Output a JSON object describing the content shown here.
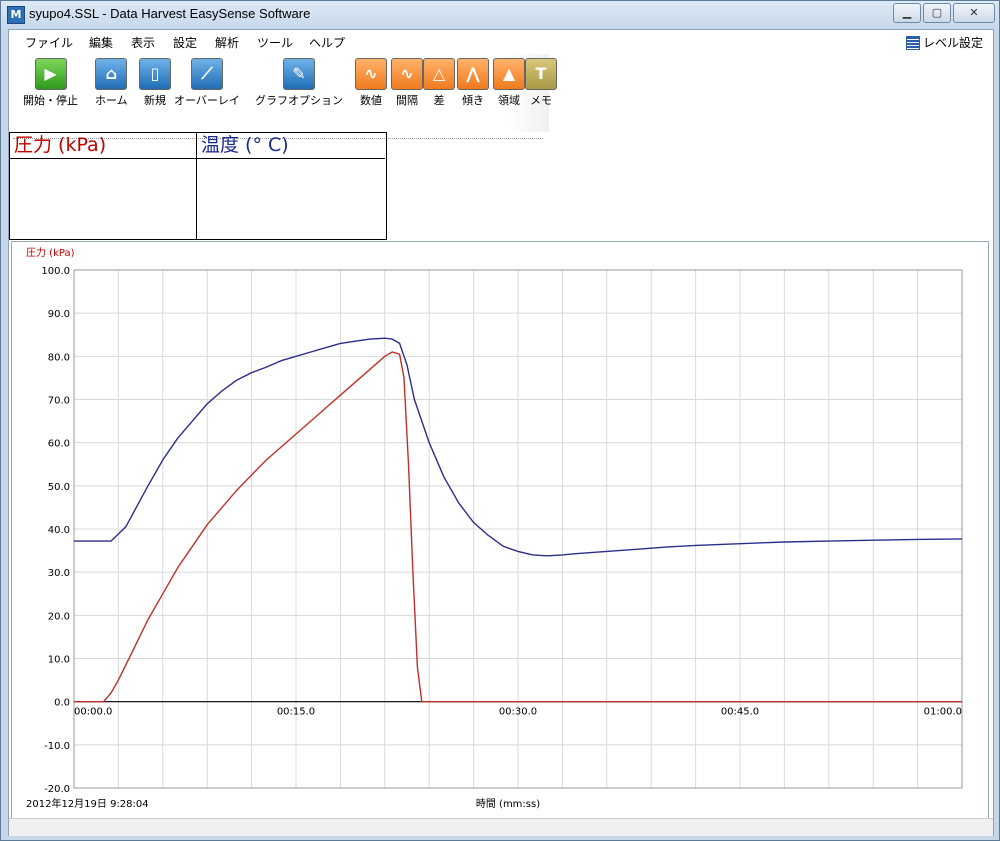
{
  "window": {
    "title": "syupo4.SSL - Data Harvest EasySense Software",
    "app_icon": "M"
  },
  "window_buttons": {
    "minimize": "▁",
    "maximize": "▢",
    "close": "✕"
  },
  "menu": [
    {
      "label": "ファイル"
    },
    {
      "label": "編集"
    },
    {
      "label": "表示"
    },
    {
      "label": "設定"
    },
    {
      "label": "解析"
    },
    {
      "label": "ツール"
    },
    {
      "label": "ヘルプ"
    }
  ],
  "level_button": {
    "label": "レベル設定",
    "icon": "list-icon"
  },
  "toolbar": [
    {
      "label": "開始・停止",
      "icon": "play-icon",
      "glyph": "▶",
      "color": "green"
    },
    {
      "label": "ホーム",
      "icon": "home-icon",
      "glyph": "⌂",
      "color": "blue"
    },
    {
      "label": "新規",
      "icon": "new-document-icon",
      "glyph": "▯",
      "color": "blue"
    },
    {
      "label": "オーバーレイ",
      "icon": "overlay-icon",
      "glyph": "⟋",
      "color": "blue"
    },
    {
      "label": "グラフオプション",
      "icon": "wrench-icon",
      "glyph": "✎",
      "color": "blue"
    },
    {
      "label": "数値",
      "icon": "value-icon",
      "glyph": "∿",
      "color": "orange"
    },
    {
      "label": "間隔",
      "icon": "interval-icon",
      "glyph": "∿",
      "color": "orange"
    },
    {
      "label": "差",
      "icon": "difference-icon",
      "glyph": "△",
      "color": "orange"
    },
    {
      "label": "傾き",
      "icon": "slope-icon",
      "glyph": "⋀",
      "color": "orange"
    },
    {
      "label": "領域",
      "icon": "area-icon",
      "glyph": "▲",
      "color": "orange"
    },
    {
      "label": "メモ",
      "icon": "memo-icon",
      "glyph": "T",
      "color": "olive"
    }
  ],
  "readouts": [
    {
      "label": "圧力 (kPa)",
      "color": "#c00000"
    },
    {
      "label": "温度 (° C)",
      "color": "#1a2a8a"
    }
  ],
  "chart_data": {
    "type": "line",
    "ylabel": "圧力 (kPa)",
    "xlabel": "時間 (mm:ss)",
    "timestamp": "2012年12月19日 9:28:04",
    "ylim": [
      -20,
      100
    ],
    "xlim": [
      0,
      60
    ],
    "yticks": [
      "100.0",
      "90.0",
      "80.0",
      "70.0",
      "60.0",
      "50.0",
      "40.0",
      "30.0",
      "20.0",
      "10.0",
      "0.0",
      "-10.0",
      "-20.0"
    ],
    "xticks": [
      {
        "value": 0,
        "label": "00:00.0"
      },
      {
        "value": 15,
        "label": "00:15.0"
      },
      {
        "value": 30,
        "label": "00:30.0"
      },
      {
        "value": 45,
        "label": "00:45.0"
      },
      {
        "value": 60,
        "label": "01:00.0"
      }
    ],
    "grid": true,
    "series": [
      {
        "color": "#2b2f8a",
        "points": [
          [
            0,
            37.2
          ],
          [
            2.5,
            37.2
          ],
          [
            3.5,
            40.5
          ],
          [
            5,
            50
          ],
          [
            6,
            56
          ],
          [
            7,
            61
          ],
          [
            8,
            65
          ],
          [
            9,
            69
          ],
          [
            10,
            72
          ],
          [
            11,
            74.5
          ],
          [
            12,
            76.2
          ],
          [
            13,
            77.5
          ],
          [
            14,
            79
          ],
          [
            15,
            80
          ],
          [
            16,
            81
          ],
          [
            17,
            82
          ],
          [
            18,
            83
          ],
          [
            19,
            83.5
          ],
          [
            20,
            84
          ],
          [
            21,
            84.2
          ],
          [
            21.5,
            84
          ],
          [
            22,
            83
          ],
          [
            22.5,
            78
          ],
          [
            23,
            70
          ],
          [
            24,
            60
          ],
          [
            25,
            52
          ],
          [
            26,
            46
          ],
          [
            27,
            41.5
          ],
          [
            28,
            38.5
          ],
          [
            29,
            36
          ],
          [
            30,
            34.8
          ],
          [
            31,
            34
          ],
          [
            32,
            33.8
          ],
          [
            33,
            34
          ],
          [
            34,
            34.3
          ],
          [
            36,
            34.8
          ],
          [
            38,
            35.3
          ],
          [
            40,
            35.8
          ],
          [
            42,
            36.2
          ],
          [
            45,
            36.6
          ],
          [
            48,
            37
          ],
          [
            51,
            37.2
          ],
          [
            54,
            37.4
          ],
          [
            57,
            37.6
          ],
          [
            60,
            37.7
          ]
        ]
      },
      {
        "color": "#c0302a",
        "points": [
          [
            0,
            0
          ],
          [
            2,
            0
          ],
          [
            2.5,
            2
          ],
          [
            3,
            5
          ],
          [
            4,
            12
          ],
          [
            5,
            19
          ],
          [
            6,
            25
          ],
          [
            7,
            31
          ],
          [
            8,
            36
          ],
          [
            9,
            41
          ],
          [
            10,
            45
          ],
          [
            11,
            49
          ],
          [
            12,
            52.5
          ],
          [
            13,
            56
          ],
          [
            14,
            59
          ],
          [
            15,
            62
          ],
          [
            16,
            65
          ],
          [
            17,
            68
          ],
          [
            18,
            71
          ],
          [
            19,
            74
          ],
          [
            20,
            77
          ],
          [
            21,
            80
          ],
          [
            21.5,
            81
          ],
          [
            22,
            80.5
          ],
          [
            22.3,
            75
          ],
          [
            22.6,
            55
          ],
          [
            22.9,
            30
          ],
          [
            23.2,
            8
          ],
          [
            23.5,
            0
          ],
          [
            60,
            0
          ]
        ]
      }
    ]
  }
}
